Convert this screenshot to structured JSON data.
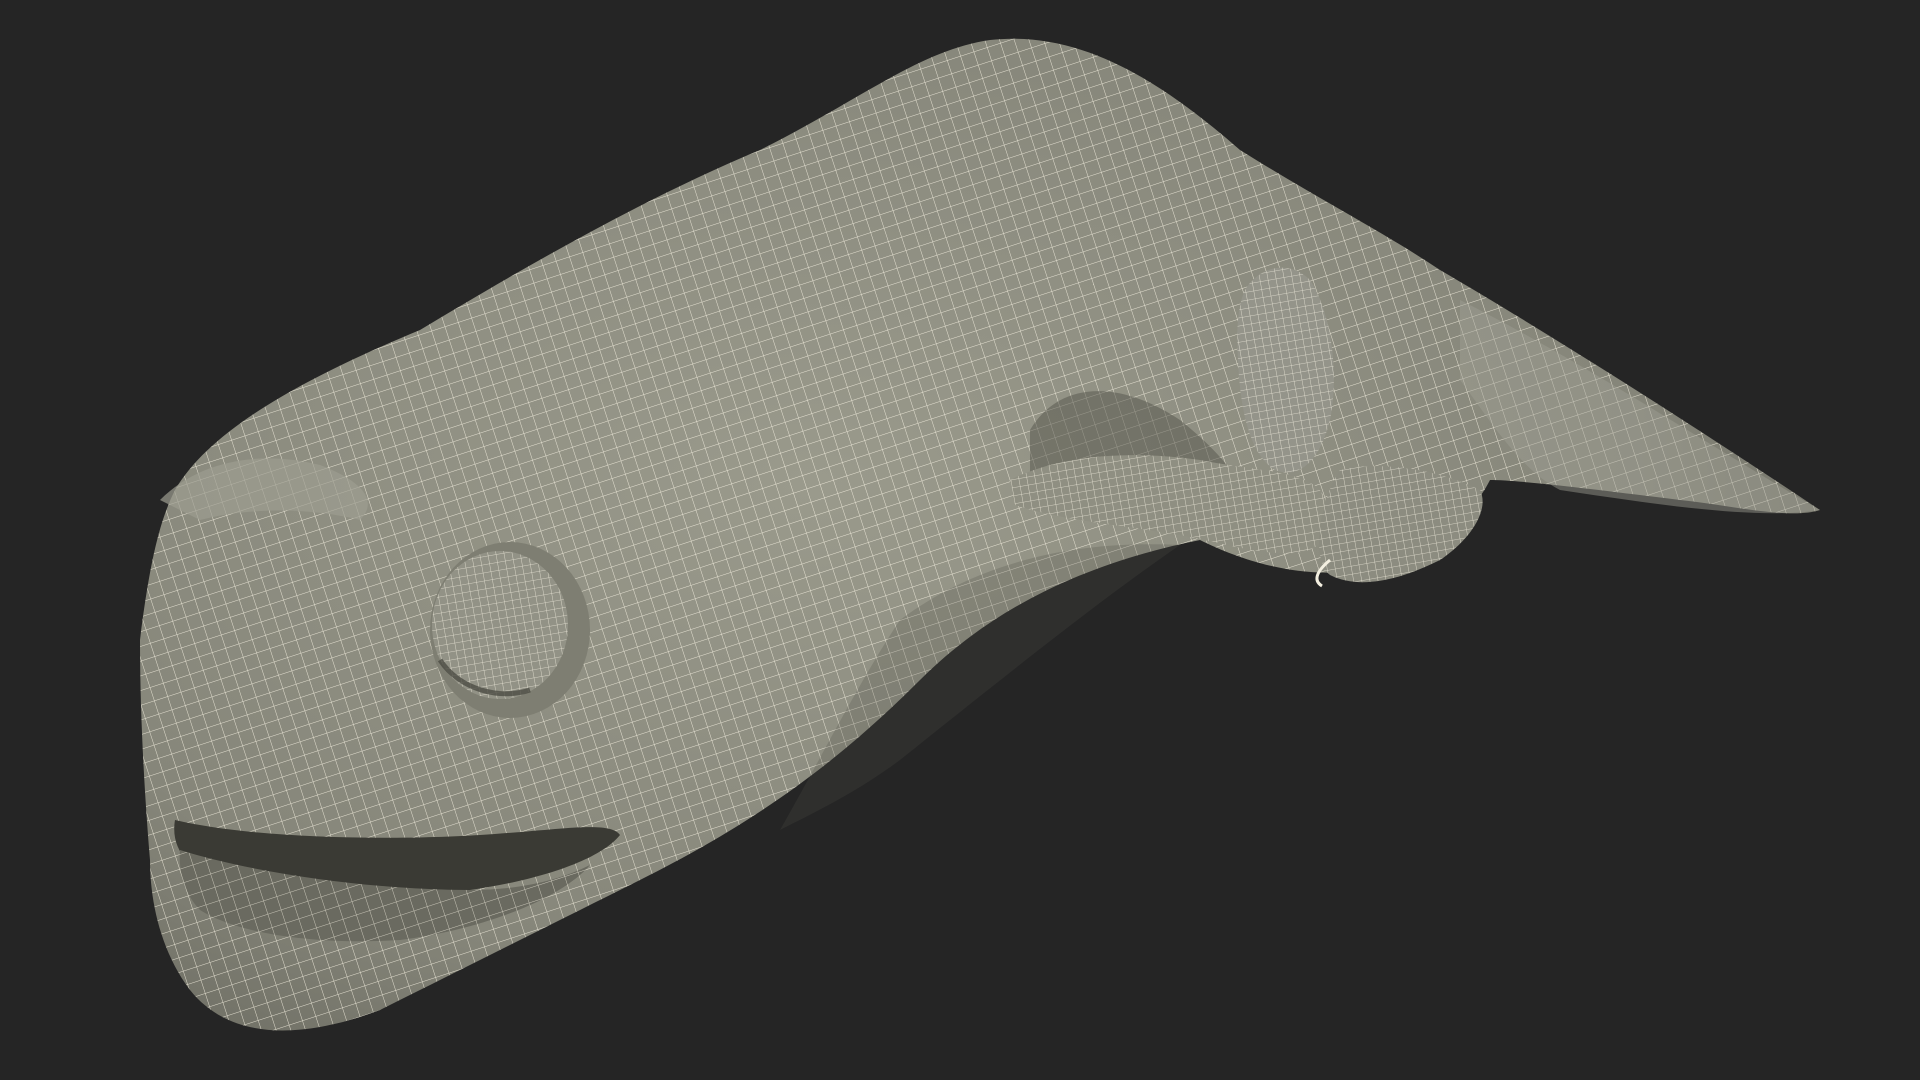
{
  "scene": {
    "subject": "wireframe-amphibian-model",
    "colors": {
      "background": "#252525",
      "surface": "#8a8a7c",
      "surface_light": "#9a9a8c",
      "surface_dark": "#5a5a50",
      "wire": "#f3efe0"
    }
  }
}
